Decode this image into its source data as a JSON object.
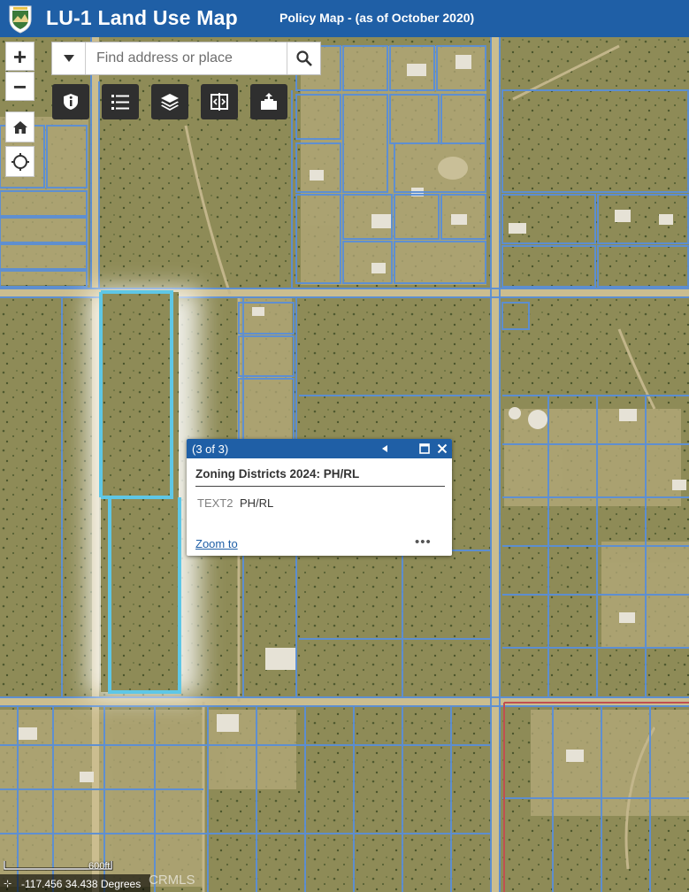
{
  "header": {
    "app_title": "LU-1 Land Use Map",
    "subtitle": "Policy Map - (as of October 2020)"
  },
  "search": {
    "placeholder": "Find address or place"
  },
  "zoom_controls": {
    "zoom_in": "+",
    "zoom_out": "−"
  },
  "icons": {
    "logo": "county-seal-icon",
    "dropdown": "caret-down-icon",
    "search": "search-icon",
    "zoom_in": "plus-icon",
    "zoom_out": "minus-icon",
    "home": "home-icon",
    "locate": "locate-icon",
    "legend": "legend-icon",
    "list": "list-icon",
    "layers": "layers-icon",
    "swipe": "swipe-icon",
    "share": "share-icon"
  },
  "popup": {
    "count": "(3 of 3)",
    "title": "Zoning Districts 2024: PH/RL",
    "field_name": "TEXT2",
    "field_value": "PH/RL",
    "zoom_to": "Zoom to",
    "more": "•••"
  },
  "scalebar": {
    "label": "600ft"
  },
  "coordinates": {
    "text": "-117.456 34.438 Degrees"
  },
  "watermark": "CRMLS",
  "colors": {
    "header_bg": "#1f5fa6",
    "parcel_line": "#5b8fd6",
    "selection": "#5ec7e6",
    "ground": "#8b8a55"
  }
}
